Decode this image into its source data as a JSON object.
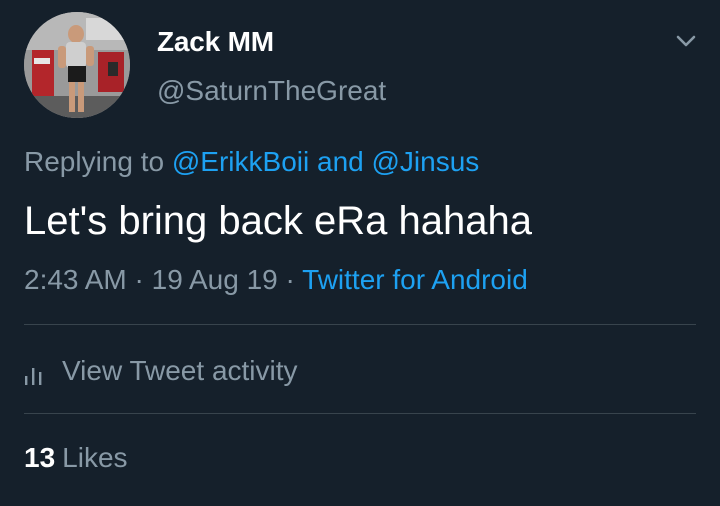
{
  "author": {
    "display_name": "Zack MM",
    "handle": "@SaturnTheGreat"
  },
  "reply": {
    "prefix": "Replying to",
    "mention_1": "@ErikkBoii",
    "conjunction": "and",
    "mention_2": "@Jinsus"
  },
  "tweet": {
    "text": "Let's bring back eRa hahaha"
  },
  "meta": {
    "time": "2:43 AM",
    "separator": "·",
    "date": "19 Aug 19",
    "source": "Twitter for Android"
  },
  "activity": {
    "label": "View Tweet activity"
  },
  "engagement": {
    "likes_count": "13",
    "likes_label": "Likes"
  },
  "icons": {
    "menu": "chevron-down-icon",
    "activity": "bar-chart-icon"
  },
  "colors": {
    "background": "#15202b",
    "text_primary": "#ffffff",
    "text_secondary": "#8899a6",
    "link": "#1da1f2",
    "divider": "#38444d"
  }
}
